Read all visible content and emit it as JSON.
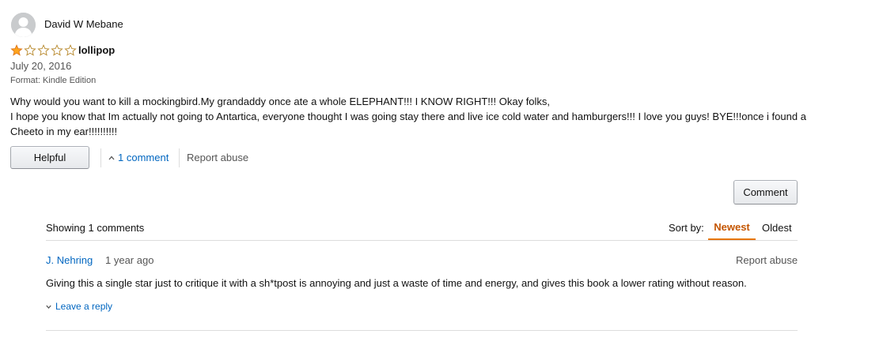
{
  "review": {
    "author": "David W Mebane",
    "rating": 1,
    "rating_max": 5,
    "title": "lollipop",
    "date": "July 20, 2016",
    "format": "Format: Kindle Edition",
    "body_lines": [
      "Why would you want to kill a mockingbird.My grandaddy once ate a whole ELEPHANT!!! I KNOW RIGHT!!! Okay folks,",
      "I hope you know that Im actually not going to Antartica, everyone thought I was going stay there and live ice cold water and hamburgers!!! I love you guys! BYE!!!once i found a",
      "Cheeto in my ear!!!!!!!!!!"
    ],
    "helpful_label": "Helpful",
    "comments_link": "1 comment",
    "report_abuse": "Report abuse"
  },
  "comments_section": {
    "comment_button": "Comment",
    "showing": "Showing 1 comments",
    "sort_label": "Sort by:",
    "sort_options": [
      "Newest",
      "Oldest"
    ],
    "sort_selected": "Newest",
    "comments": [
      {
        "author": "J. Nehring",
        "time": "1 year ago",
        "report": "Report abuse",
        "text": "Giving this a single star just to critique it with a sh*tpost is annoying and just a waste of time and energy, and gives this book a lower rating without reason.",
        "reply_label": "Leave a reply"
      }
    ]
  },
  "colors": {
    "link": "#0066c0",
    "star": "#ffa41c",
    "sort_active": "#c45500",
    "sort_underline": "#e77600",
    "muted": "#555555"
  },
  "icons": {
    "avatar": "default-user-avatar-icon",
    "star_filled": "star-filled-icon",
    "star_empty": "star-outline-icon",
    "comments_toggle": "chevron-up-icon",
    "reply_toggle": "chevron-down-icon"
  }
}
